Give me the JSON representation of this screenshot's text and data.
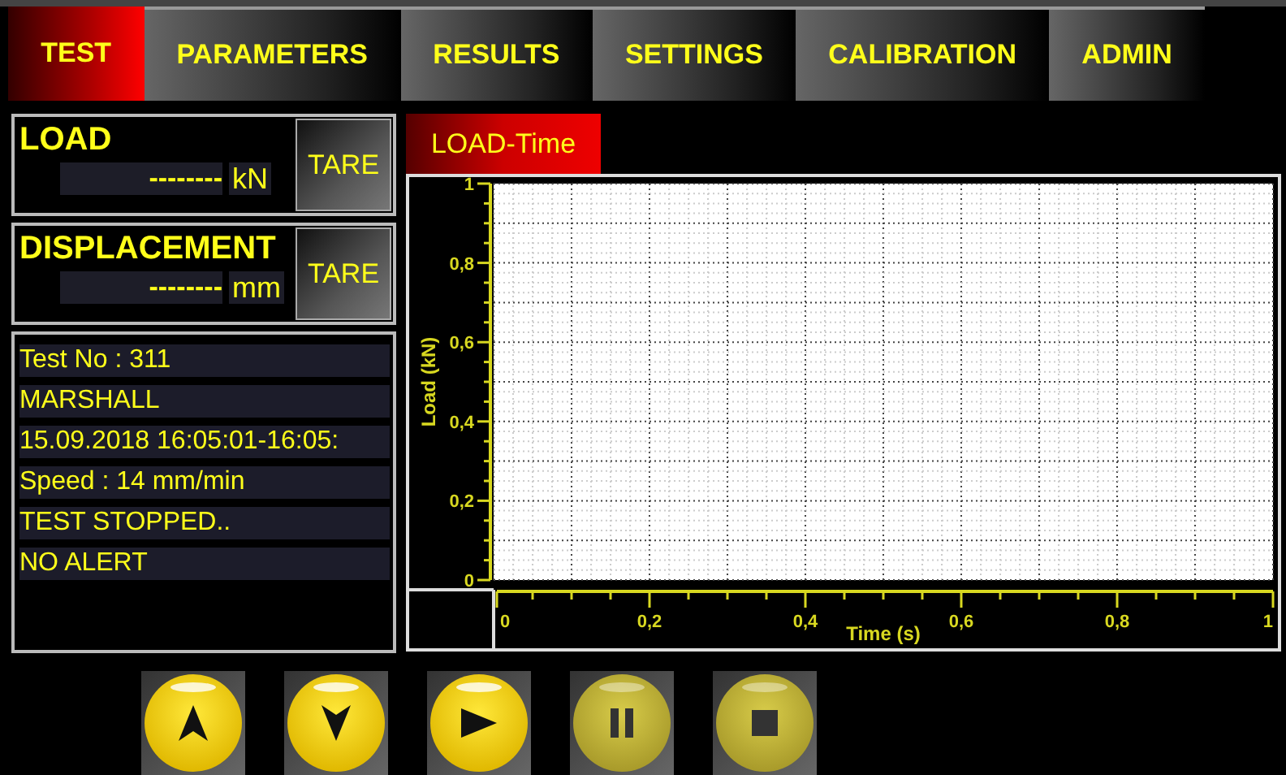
{
  "tabs": [
    {
      "label": "TEST",
      "selected": true
    },
    {
      "label": "PARAMETERS",
      "selected": false
    },
    {
      "label": "RESULTS",
      "selected": false
    },
    {
      "label": "SETTINGS",
      "selected": false
    },
    {
      "label": "CALIBRATION",
      "selected": false
    },
    {
      "label": "ADMIN",
      "selected": false
    }
  ],
  "readouts": [
    {
      "title": "LOAD",
      "value": "--------",
      "unit": "kN",
      "button": "TARE"
    },
    {
      "title": "DISPLACEMENT",
      "value": "--------",
      "unit": "mm",
      "button": "TARE"
    }
  ],
  "info_lines": [
    "Test No : 311",
    "MARSHALL",
    "15.09.2018 16:05:01-16:05:",
    "Speed : 14 mm/min",
    "TEST STOPPED..",
    "NO ALERT"
  ],
  "chart_tab": {
    "label": "LOAD-Time",
    "selected": true
  },
  "chart": {
    "chart_data": {
      "type": "line",
      "grid": true,
      "xlabel": "Time (s)",
      "ylabel": "Load (kN)",
      "xlim": [
        0,
        1
      ],
      "ylim": [
        0,
        1
      ],
      "xticks": [
        {
          "value": 0,
          "label": "0"
        },
        {
          "value": 0.2,
          "label": "0,2"
        },
        {
          "value": 0.4,
          "label": "0,4"
        },
        {
          "value": 0.6,
          "label": "0,6"
        },
        {
          "value": 0.8,
          "label": "0,8"
        },
        {
          "value": 1,
          "label": "1"
        }
      ],
      "yticks": [
        {
          "value": 0,
          "label": "0"
        },
        {
          "value": 0.2,
          "label": "0,2"
        },
        {
          "value": 0.4,
          "label": "0,4"
        },
        {
          "value": 0.6,
          "label": "0,6"
        },
        {
          "value": 0.8,
          "label": "0,8"
        },
        {
          "value": 1,
          "label": "1"
        }
      ]
    }
  },
  "controls": [
    {
      "kind": "up",
      "disabled": false
    },
    {
      "kind": "down",
      "disabled": false
    },
    {
      "kind": "play",
      "disabled": false
    },
    {
      "kind": "pause",
      "disabled": true
    },
    {
      "kind": "stop",
      "disabled": true
    }
  ]
}
